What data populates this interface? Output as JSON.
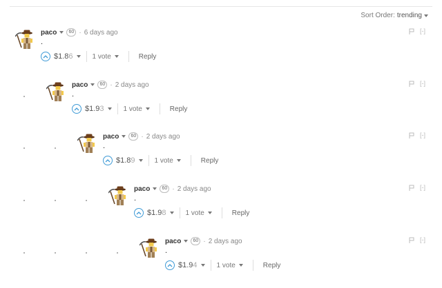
{
  "sort": {
    "label": "Sort Order:",
    "value": "trending"
  },
  "comments": [
    {
      "author": "paco",
      "reputation": "60",
      "time": "6 days ago",
      "body": ".",
      "payout_main": "$1.8",
      "payout_tail": "6",
      "votes": "1 vote",
      "reply": "Reply",
      "collapse": "[-]"
    },
    {
      "author": "paco",
      "reputation": "60",
      "time": "2 days ago",
      "body": ".",
      "payout_main": "$1.9",
      "payout_tail": "3",
      "votes": "1 vote",
      "reply": "Reply",
      "collapse": "[-]"
    },
    {
      "author": "paco",
      "reputation": "60",
      "time": "2 days ago",
      "body": ".",
      "payout_main": "$1.8",
      "payout_tail": "9",
      "votes": "1 vote",
      "reply": "Reply",
      "collapse": "[-]"
    },
    {
      "author": "paco",
      "reputation": "60",
      "time": "2 days ago",
      "body": ".",
      "payout_main": "$1.9",
      "payout_tail": "8",
      "votes": "1 vote",
      "reply": "Reply",
      "collapse": "[-]"
    },
    {
      "author": "paco",
      "reputation": "60",
      "time": "2 days ago",
      "body": ".",
      "payout_main": "$1.9",
      "payout_tail": "4",
      "votes": "1 vote",
      "reply": "Reply",
      "collapse": "[-]"
    }
  ],
  "icons": {
    "upvote": "upvote-icon",
    "flag": "flag-icon",
    "caret": "caret-down-icon",
    "avatar": "avatar-miner-icon"
  },
  "colors": {
    "accent": "#3e9ad6"
  }
}
